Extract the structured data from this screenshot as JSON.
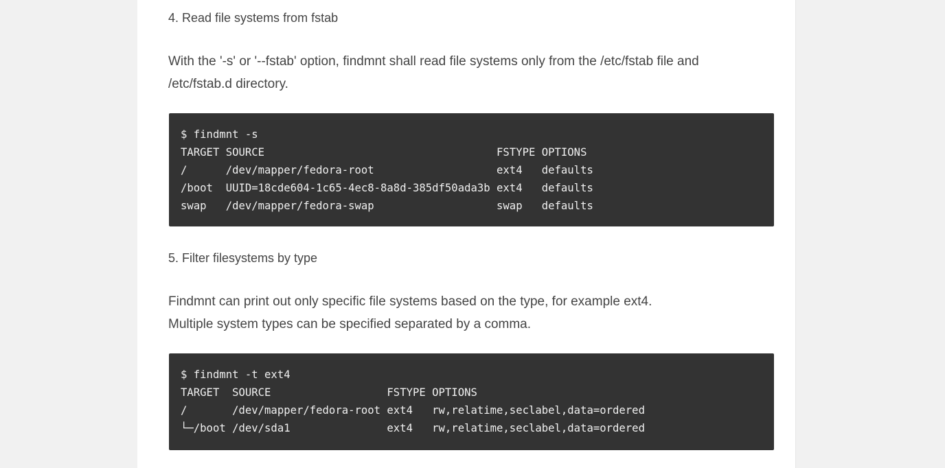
{
  "sections": [
    {
      "heading": "4. Read file systems from fstab",
      "paragraph_lines": [
        "With the '-s' or '--fstab' option, findmnt shall read file systems only from the /etc/fstab file and",
        "/etc/fstab.d directory."
      ],
      "code_lines": [
        "$ findmnt -s",
        "TARGET SOURCE                                    FSTYPE OPTIONS",
        "/      /dev/mapper/fedora-root                   ext4   defaults",
        "/boot  UUID=18cde604-1c65-4ec8-8a8d-385df50ada3b ext4   defaults",
        "swap   /dev/mapper/fedora-swap                   swap   defaults"
      ]
    },
    {
      "heading": "5. Filter filesystems by type",
      "paragraph_lines": [
        "Findmnt can print out only specific file systems based on the type, for example ext4.",
        "Multiple system types can be specified separated by a comma."
      ],
      "code_lines": [
        "$ findmnt -t ext4",
        "TARGET  SOURCE                  FSTYPE OPTIONS",
        "/       /dev/mapper/fedora-root ext4   rw,relatime,seclabel,data=ordered",
        "└─/boot /dev/sda1               ext4   rw,relatime,seclabel,data=ordered"
      ]
    }
  ],
  "colors": {
    "page_background": "#f1f1f1",
    "card_background": "#ffffff",
    "text": "#444444",
    "code_background": "#333333",
    "code_text": "#f0f0f0"
  }
}
